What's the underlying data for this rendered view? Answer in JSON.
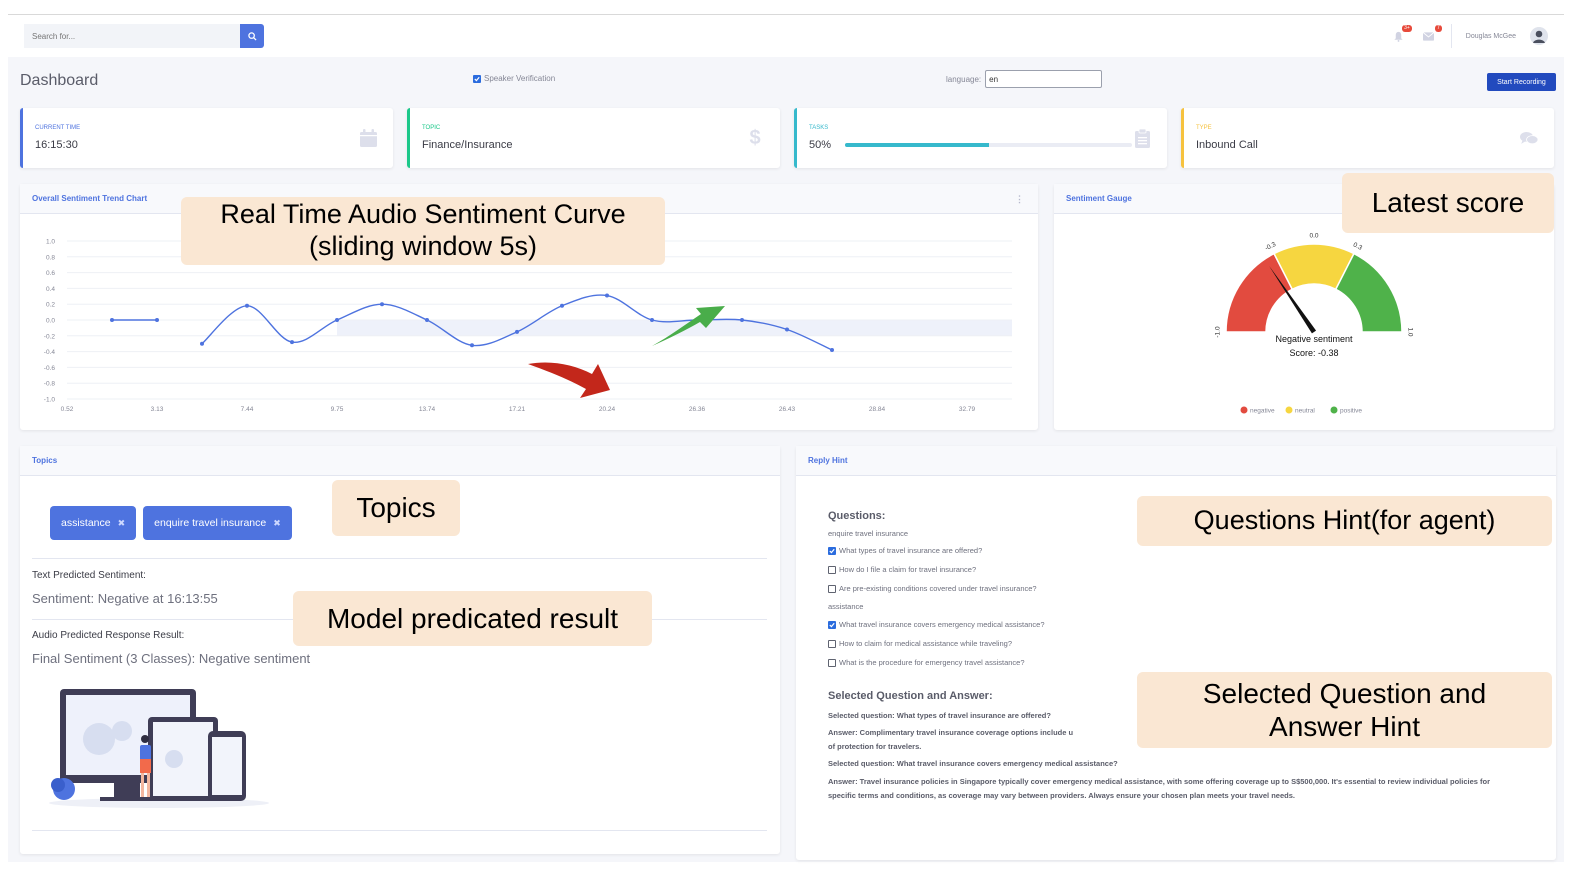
{
  "header": {
    "search_placeholder": "Search for...",
    "user_name": "Douglas McGee",
    "alert_badge": "3+",
    "message_badge": "7"
  },
  "page": {
    "title": "Dashboard",
    "speaker_verification_label": "Speaker Verification",
    "speaker_verification_checked": true,
    "language_label": "language:",
    "language_value": "en",
    "record_button": "Start Recording"
  },
  "kpis": [
    {
      "label": "CURRENT TIME",
      "value": "16:15:30",
      "accent": "#4e73df",
      "icon": "calendar-icon"
    },
    {
      "label": "TOPIC",
      "value": "Finance/Insurance",
      "accent": "#1cc88a",
      "icon": "dollar-icon"
    },
    {
      "label": "TASKS",
      "value": "50%",
      "progress": 0.5,
      "accent": "#36b9cc",
      "icon": "clipboard-icon"
    },
    {
      "label": "TYPE",
      "value": "Inbound Call",
      "accent": "#f6c23e",
      "icon": "comments-icon"
    }
  ],
  "trend_card": {
    "title": "Overall Sentiment Trend Chart"
  },
  "gauge_card": {
    "title": "Sentiment Gauge"
  },
  "chart_data": [
    {
      "type": "line",
      "title": "Overall Sentiment Trend Chart",
      "x_tick_labels": [
        "0.52",
        "3.13",
        "7.44",
        "9.75",
        "13.74",
        "17.21",
        "20.24",
        "26.36",
        "26.43",
        "28.84",
        "32.79"
      ],
      "y_tick_labels": [
        "1.0",
        "0.8",
        "0.6",
        "0.4",
        "0.2",
        "0.0",
        "-0.2",
        "-0.4",
        "-0.6",
        "-0.8",
        "-1.0"
      ],
      "ylim": [
        -1.0,
        1.0
      ],
      "grid": true,
      "series": [
        {
          "segment": 1,
          "x_index": [
            1,
            2
          ],
          "values": [
            0.0,
            0.0
          ]
        },
        {
          "segment": 2,
          "x_index": [
            3,
            4,
            5,
            6,
            7,
            8,
            9,
            10,
            11,
            12,
            13,
            14,
            15,
            16,
            17,
            18,
            19,
            20,
            21
          ],
          "values": [
            -0.3,
            0.18,
            -0.28,
            0.0,
            0.2,
            0.0,
            -0.32,
            -0.15,
            0.18,
            0.31,
            0.0,
            0.0,
            0.0,
            -0.12,
            -0.38
          ]
        }
      ],
      "color": "#4e73df"
    },
    {
      "type": "gauge",
      "title": "Sentiment Gauge",
      "range": [
        -1.0,
        1.0
      ],
      "value": -0.38,
      "tick_labels": [
        "-1.0",
        "-0.3",
        "0.0",
        "0.3",
        "1.0"
      ],
      "bands": [
        {
          "name": "negative",
          "from": -1.0,
          "to": -0.3,
          "color": "#e24b3f"
        },
        {
          "name": "neutral",
          "from": -0.3,
          "to": 0.3,
          "color": "#f6d640"
        },
        {
          "name": "positive",
          "from": 0.3,
          "to": 1.0,
          "color": "#4fb24a"
        }
      ],
      "label": "Negative sentiment",
      "score_text": "Score: -0.38",
      "legend": [
        "negative",
        "neutral",
        "positive"
      ]
    }
  ],
  "topics": {
    "title": "Topics",
    "tags": [
      "assistance",
      "enquire travel insurance"
    ],
    "text_sentiment_label": "Text Predicted Sentiment:",
    "text_sentiment_value": "Sentiment: Negative at 16:13:55",
    "audio_result_label": "Audio Predicted Response Result:",
    "audio_result_value": "Final Sentiment (3 Classes): Negative sentiment"
  },
  "reply_hint": {
    "title": "Reply Hint",
    "questions_heading": "Questions:",
    "groups": [
      {
        "name": "enquire travel insurance",
        "questions": [
          {
            "text": "What types of travel insurance are offered?",
            "checked": true
          },
          {
            "text": "How do I file a claim for travel insurance?",
            "checked": false
          },
          {
            "text": "Are pre-existing conditions covered under travel insurance?",
            "checked": false
          }
        ]
      },
      {
        "name": "assistance",
        "questions": [
          {
            "text": "What travel insurance covers emergency medical assistance?",
            "checked": true
          },
          {
            "text": "How to claim for medical assistance while traveling?",
            "checked": false
          },
          {
            "text": "What is the procedure for emergency travel assistance?",
            "checked": false
          }
        ]
      }
    ],
    "selected_heading": "Selected Question and Answer:",
    "qa": [
      {
        "question": "Selected question: What types of travel insurance are offered?",
        "answer": "Answer: Complimentary travel insurance coverage options include u",
        "answer_cont": "of protection for travelers."
      },
      {
        "question": "Selected question: What travel insurance covers emergency medical assistance?",
        "answer": "Answer: Travel insurance policies in Singapore typically cover emergency medical assistance, with some offering coverage up to S$500,000. It's essential to review individual policies for specific terms and conditions, as coverage may vary between providers. Always ensure your chosen plan meets your travel needs."
      }
    ]
  },
  "callouts": {
    "curve": [
      "Real Time Audio Sentiment Curve",
      "(sliding window 5s)"
    ],
    "latest": "Latest score",
    "topics": "Topics",
    "model": "Model predicated result",
    "questions_hint": "Questions Hint(for agent)",
    "selected_hint": [
      "Selected Question and",
      "Answer Hint"
    ]
  }
}
